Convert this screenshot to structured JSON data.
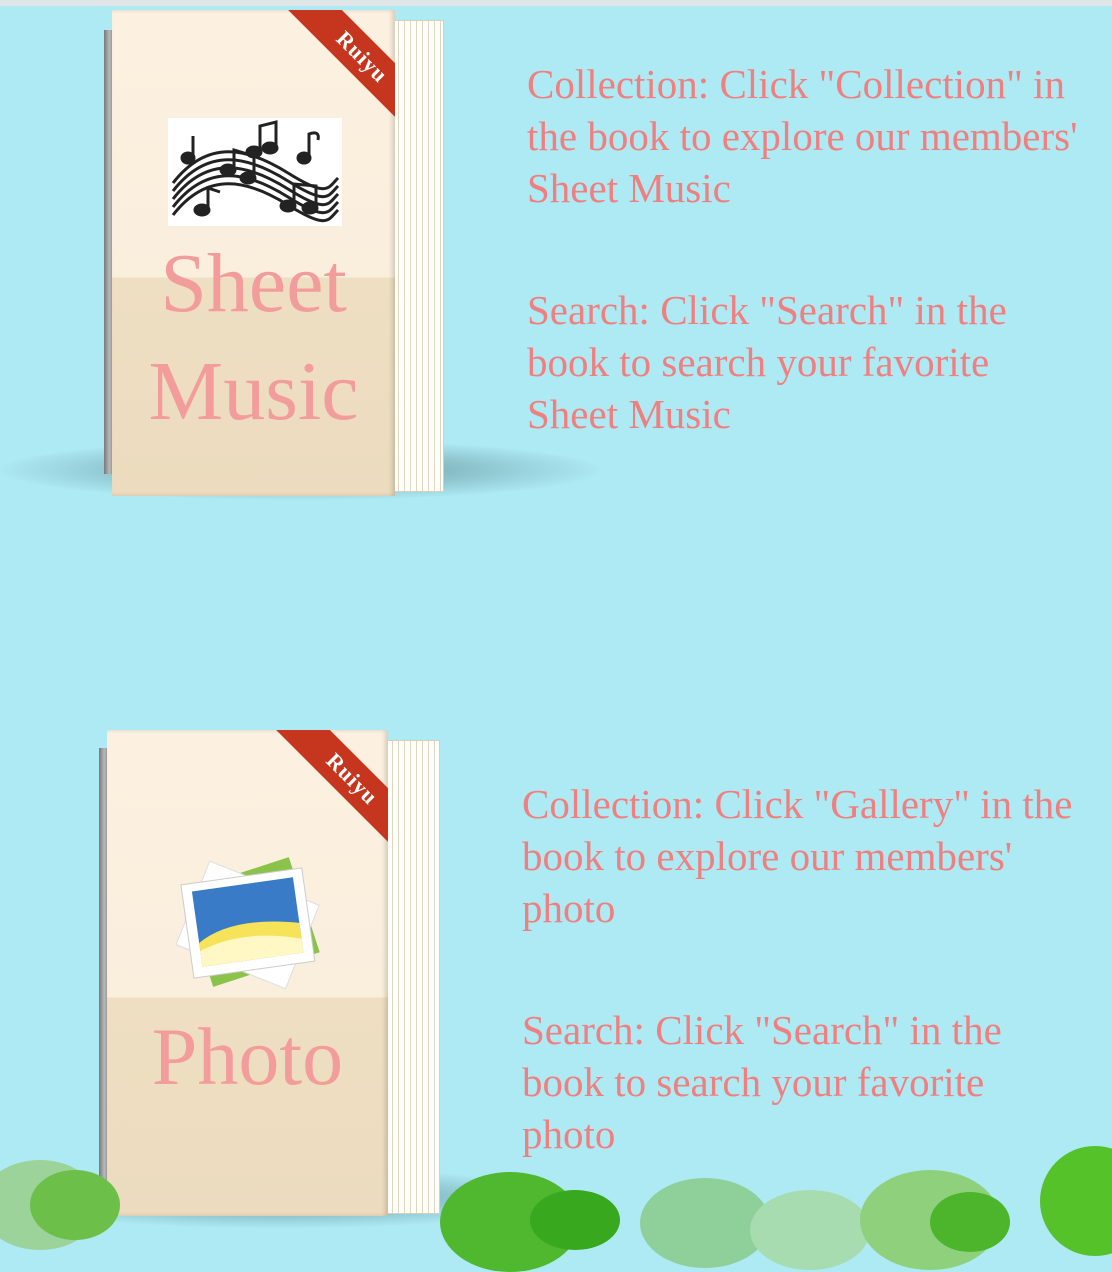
{
  "books": [
    {
      "ribbon": "Ruiyu",
      "title_line1": "Sheet",
      "title_line2": "Music",
      "icon": "music-notes-icon"
    },
    {
      "ribbon": "Ruiyu",
      "title_line1": "Photo",
      "icon": "photo-gallery-icon"
    }
  ],
  "sections": [
    {
      "collection_text": "Collection: Click \"Collection\" in the book to explore our members' Sheet Music",
      "search_text": "Search: Click \"Search\" in the book to search your favorite Sheet Music"
    },
    {
      "collection_text": "Collection: Click \"Gallery\" in the book to explore our members' photo",
      "search_text": "Search: Click \"Search\" in the book to search your favorite photo"
    }
  ],
  "colors": {
    "background": "#aeeaf4",
    "text": "#f07f7f",
    "ribbon": "#c6361f",
    "cover_title": "#f39c9c"
  }
}
